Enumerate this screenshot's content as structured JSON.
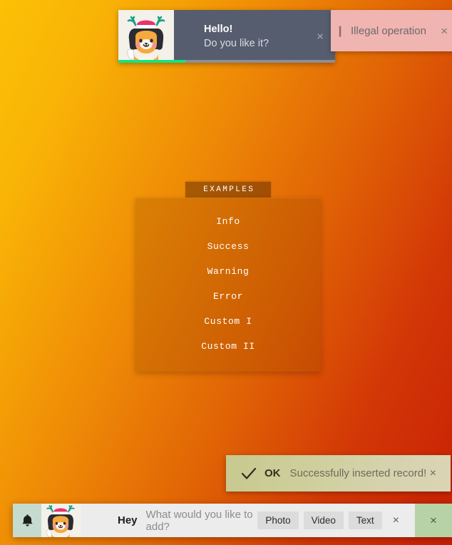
{
  "background": {
    "from_color": "#fcc005",
    "to_color": "#c81f04"
  },
  "hello_toast": {
    "title": "Hello!",
    "subtitle": "Do you like it?",
    "close_label": "×",
    "avatar_name": "shiba-reindeer-avatar",
    "progress_percent": 31,
    "progress_color": "#12e57f",
    "background_color": "#565d6e"
  },
  "illegal_toast": {
    "icon": "❙",
    "text": "Illegal operation",
    "close_label": "×",
    "background_color": "#f0b4b1"
  },
  "examples_menu": {
    "tab_label": "EXAMPLES",
    "items": [
      {
        "label": "Info"
      },
      {
        "label": "Success"
      },
      {
        "label": "Warning"
      },
      {
        "label": "Error"
      },
      {
        "label": "Custom I"
      },
      {
        "label": "Custom II"
      }
    ]
  },
  "ok_toast": {
    "icon": "check-icon",
    "label": "OK",
    "message": "Successfully inserted record!",
    "close_label": "×"
  },
  "bottom_bar": {
    "bell_icon": "bell-icon",
    "avatar_name": "shiba-reindeer-avatar",
    "greeting": "Hey",
    "placeholder": "What would you like to add?",
    "actions": [
      {
        "label": "Photo"
      },
      {
        "label": "Video"
      },
      {
        "label": "Text"
      }
    ],
    "close_label": "×",
    "dismiss_label": "×",
    "dismiss_color": "#b6d3a6"
  }
}
